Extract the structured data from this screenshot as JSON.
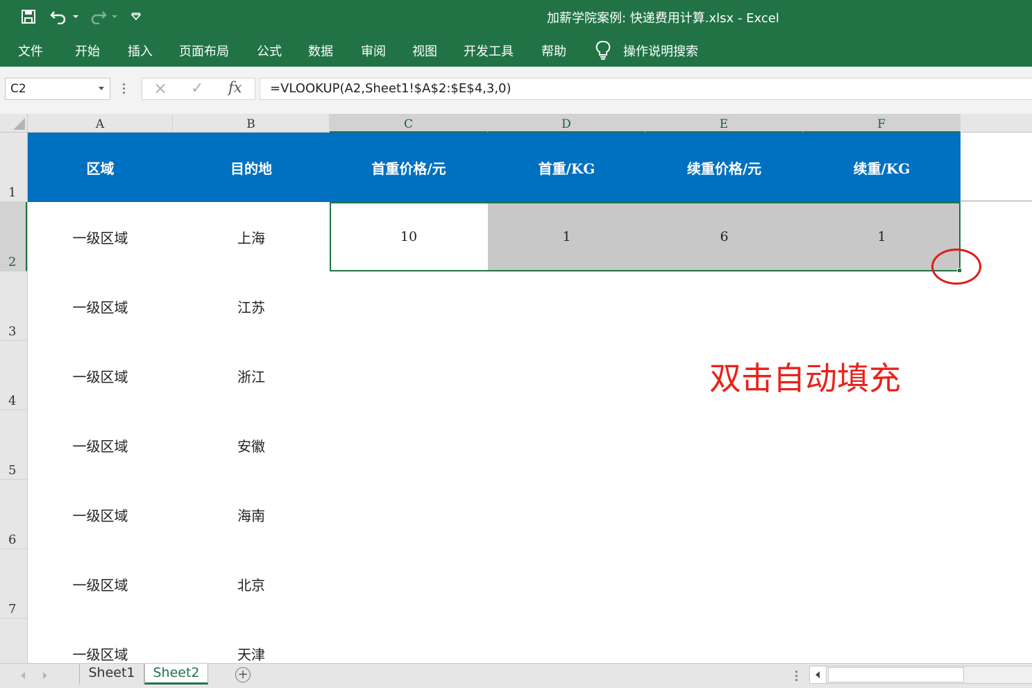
{
  "title_bar": {
    "document_title": "加薪学院案例: 快递费用计算.xlsx  -  Excel",
    "quick_access": [
      "save-icon",
      "undo-icon",
      "redo-icon",
      "customize-icon"
    ]
  },
  "ribbon": {
    "tabs": [
      "文件",
      "开始",
      "插入",
      "页面布局",
      "公式",
      "数据",
      "审阅",
      "视图",
      "开发工具",
      "帮助"
    ],
    "tell_me": "操作说明搜索"
  },
  "formula_bar": {
    "name_box": "C2",
    "cancel_icon": "×",
    "enter_icon": "✓",
    "fx_label": "fx",
    "formula": "=VLOOKUP(A2,Sheet1!$A$2:$E$4,3,0)"
  },
  "columns": [
    "A",
    "B",
    "C",
    "D",
    "E",
    "F"
  ],
  "rows": [
    "1",
    "2",
    "3",
    "4",
    "5",
    "6",
    "7"
  ],
  "sheet": {
    "header": [
      "区域",
      "目的地",
      "首重价格/元",
      "首重/KG",
      "续重价格/元",
      "续重/KG"
    ],
    "data": [
      [
        "一级区域",
        "上海",
        "10",
        "1",
        "6",
        "1"
      ],
      [
        "一级区域",
        "江苏",
        "",
        "",
        "",
        ""
      ],
      [
        "一级区域",
        "浙江",
        "",
        "",
        "",
        ""
      ],
      [
        "一级区域",
        "安徽",
        "",
        "",
        "",
        ""
      ],
      [
        "一级区域",
        "海南",
        "",
        "",
        "",
        ""
      ],
      [
        "一级区域",
        "北京",
        "",
        "",
        "",
        ""
      ],
      [
        "一级区域",
        "天津",
        "",
        "",
        "",
        ""
      ]
    ]
  },
  "annotation": {
    "text": "双击自动填充",
    "color": "#e8231b"
  },
  "sheet_tabs": [
    "Sheet1",
    "Sheet2"
  ],
  "active_sheet": "Sheet2",
  "add_sheet_label": "+",
  "colors": {
    "excel_green": "#217346",
    "header_blue": "#0070c0",
    "selection_grey": "#c8c8c8"
  }
}
